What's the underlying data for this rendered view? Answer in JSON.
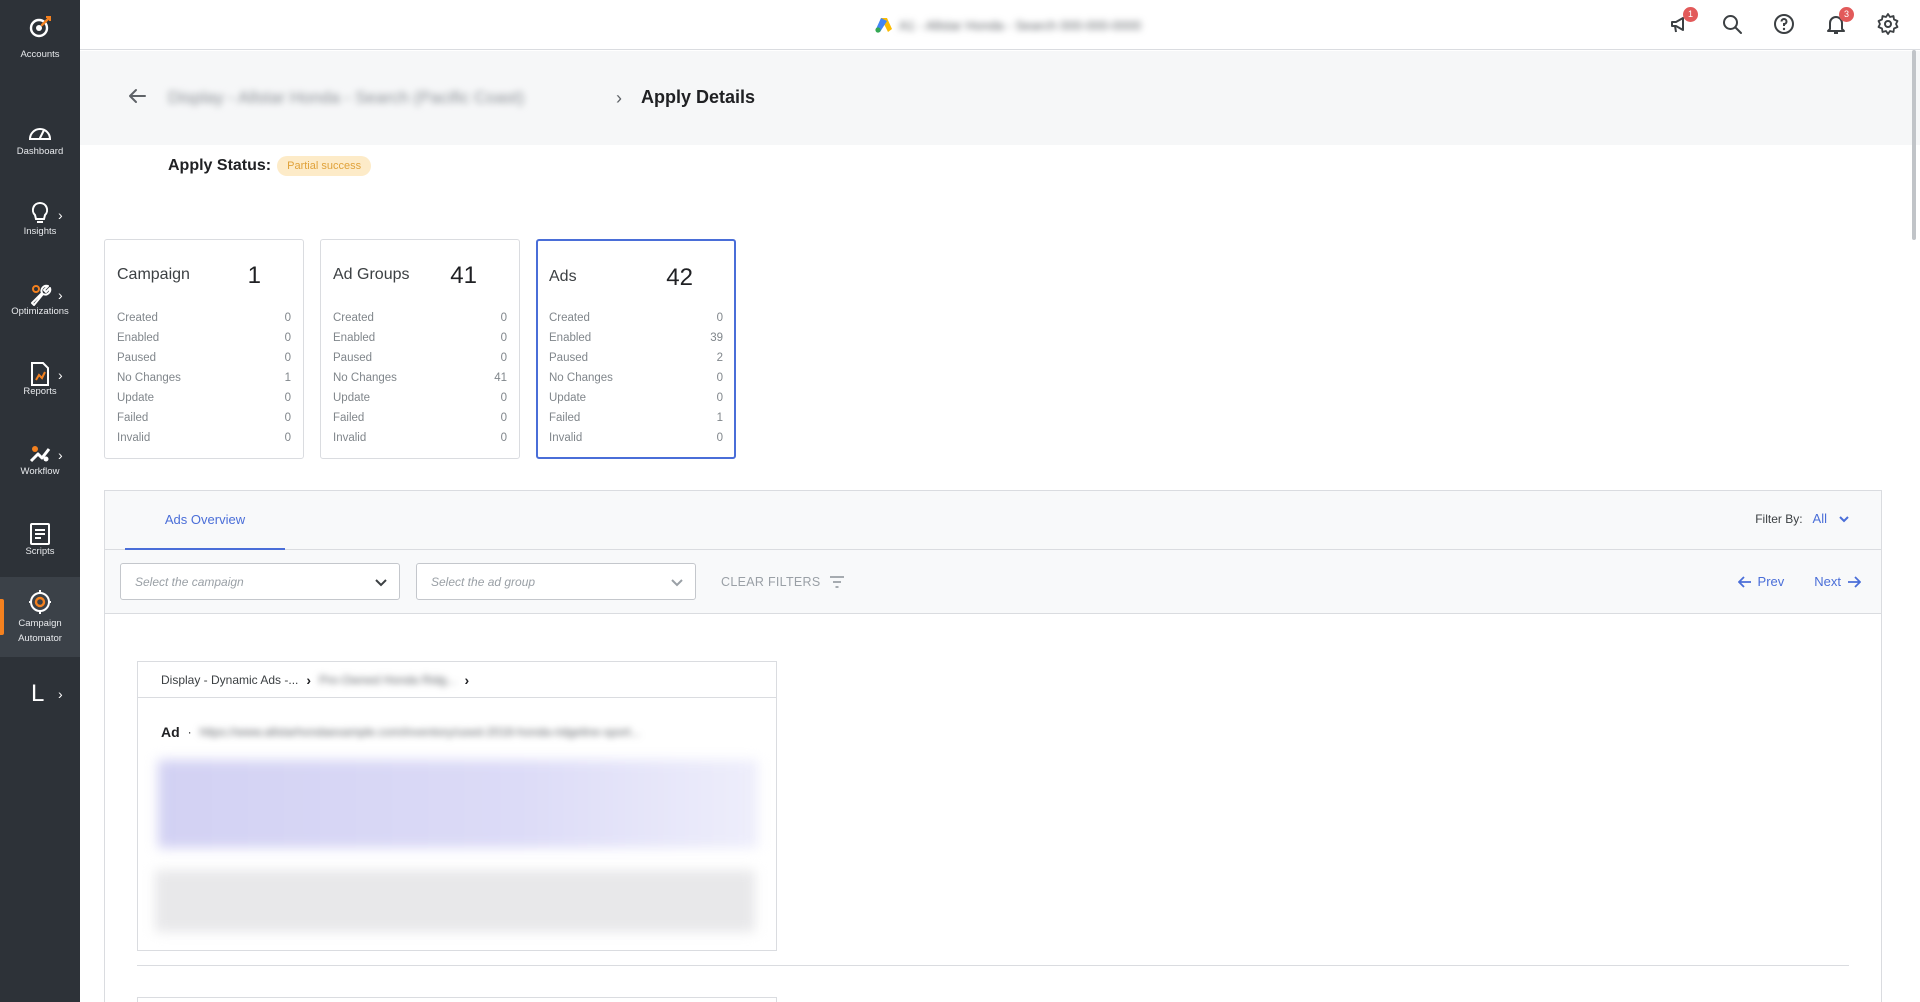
{
  "sidebar": {
    "items": [
      {
        "label": "Accounts",
        "icon": "accounts-icon"
      },
      {
        "label": "Dashboard",
        "icon": "dashboard-icon"
      },
      {
        "label": "Insights",
        "icon": "lightbulb-icon"
      },
      {
        "label": "Optimizations",
        "icon": "wrench-icon"
      },
      {
        "label": "Reports",
        "icon": "report-icon"
      },
      {
        "label": "Workflow",
        "icon": "workflow-icon"
      },
      {
        "label": "Scripts",
        "icon": "scripts-icon"
      },
      {
        "label": "Campaign Automator",
        "icon": "campaign-automator-icon"
      }
    ],
    "user_initial": "L"
  },
  "topbar": {
    "account_name": "A1 - Allstar Honda - Search 000-000-0000",
    "notification_badges": {
      "announcements": "1",
      "alerts": "3"
    }
  },
  "header": {
    "breadcrumb_parent": "Display - Allstar Honda - Search (Pacific Coast)",
    "breadcrumb_separator": "›",
    "title": "Apply Details"
  },
  "apply_status": {
    "label": "Apply Status:",
    "value": "Partial success"
  },
  "cards": [
    {
      "title": "Campaign",
      "count": "1",
      "rows": [
        {
          "label": "Created",
          "value": "0"
        },
        {
          "label": "Enabled",
          "value": "0"
        },
        {
          "label": "Paused",
          "value": "0"
        },
        {
          "label": "No Changes",
          "value": "1"
        },
        {
          "label": "Update",
          "value": "0"
        },
        {
          "label": "Failed",
          "value": "0"
        },
        {
          "label": "Invalid",
          "value": "0"
        }
      ]
    },
    {
      "title": "Ad Groups",
      "count": "41",
      "rows": [
        {
          "label": "Created",
          "value": "0"
        },
        {
          "label": "Enabled",
          "value": "0"
        },
        {
          "label": "Paused",
          "value": "0"
        },
        {
          "label": "No Changes",
          "value": "41"
        },
        {
          "label": "Update",
          "value": "0"
        },
        {
          "label": "Failed",
          "value": "0"
        },
        {
          "label": "Invalid",
          "value": "0"
        }
      ]
    },
    {
      "title": "Ads",
      "count": "42",
      "rows": [
        {
          "label": "Created",
          "value": "0"
        },
        {
          "label": "Enabled",
          "value": "39"
        },
        {
          "label": "Paused",
          "value": "2"
        },
        {
          "label": "No Changes",
          "value": "0"
        },
        {
          "label": "Update",
          "value": "0"
        },
        {
          "label": "Failed",
          "value": "1"
        },
        {
          "label": "Invalid",
          "value": "0"
        }
      ]
    }
  ],
  "panel": {
    "tab_label": "Ads Overview",
    "filter_by_label": "Filter By:",
    "filter_by_value": "All",
    "campaign_select_placeholder": "Select the campaign",
    "adgroup_select_placeholder": "Select the ad group",
    "clear_filters_label": "CLEAR FILTERS",
    "prev_label": "Prev",
    "next_label": "Next"
  },
  "ad": {
    "campaign_crumb": "Display - Dynamic Ads -...",
    "adgroup_crumb": "Pre-Owned Honda Ridg...",
    "ad_label": "Ad",
    "ad_separator": "·",
    "ad_url": "https://www.allstarhondaexample.com/inventory/used-2018-honda-ridgeline-sport..."
  },
  "colors": {
    "sidebar_bg": "#2d3238",
    "accent_blue": "#4a6ed8",
    "status_warning_bg": "#fdebc8",
    "status_warning_text": "#e0a23a",
    "active_indicator": "#f4811f"
  }
}
